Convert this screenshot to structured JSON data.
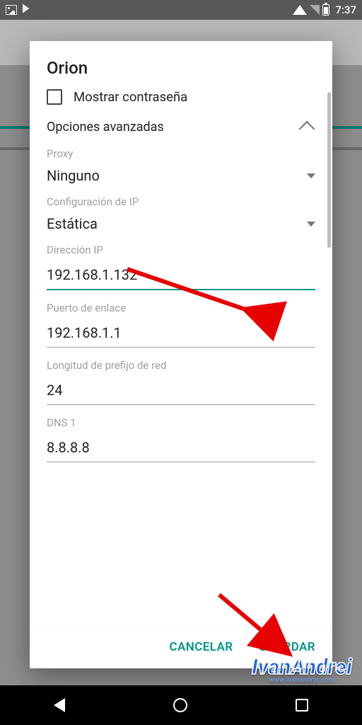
{
  "status": {
    "time": "7:37"
  },
  "dialog": {
    "title": "Orion",
    "show_password_label": "Mostrar contraseña",
    "advanced_label": "Opciones avanzadas",
    "proxy_label": "Proxy",
    "proxy_value": "Ninguno",
    "ip_config_label": "Configuración de IP",
    "ip_config_value": "Estática",
    "ip_address_label": "Dirección IP",
    "ip_address_value": "192.168.1.132",
    "gateway_label": "Puerto de enlace",
    "gateway_value": "192.168.1.1",
    "prefix_label": "Longitud de prefijo de red",
    "prefix_value": "24",
    "dns1_label": "DNS 1",
    "dns1_value": "8.8.8.8",
    "cancel_label": "CANCELAR",
    "save_label": "GUARDAR"
  },
  "watermark": {
    "text": "IvanAndrei",
    "url": "www.ivanandrei.com"
  },
  "colors": {
    "accent": "#009688",
    "arrow": "#e60000"
  }
}
